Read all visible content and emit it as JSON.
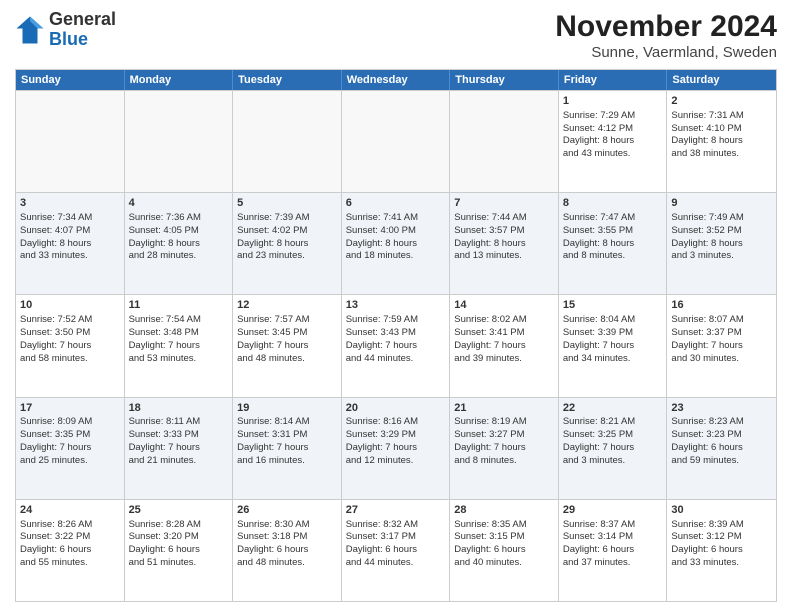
{
  "header": {
    "logo_general": "General",
    "logo_blue": "Blue",
    "month_title": "November 2024",
    "location": "Sunne, Vaermland, Sweden"
  },
  "days_of_week": [
    "Sunday",
    "Monday",
    "Tuesday",
    "Wednesday",
    "Thursday",
    "Friday",
    "Saturday"
  ],
  "weeks": [
    [
      {
        "day": "",
        "empty": true
      },
      {
        "day": "",
        "empty": true
      },
      {
        "day": "",
        "empty": true
      },
      {
        "day": "",
        "empty": true
      },
      {
        "day": "",
        "empty": true
      },
      {
        "day": "1",
        "lines": [
          "Sunrise: 7:29 AM",
          "Sunset: 4:12 PM",
          "Daylight: 8 hours",
          "and 43 minutes."
        ]
      },
      {
        "day": "2",
        "lines": [
          "Sunrise: 7:31 AM",
          "Sunset: 4:10 PM",
          "Daylight: 8 hours",
          "and 38 minutes."
        ]
      }
    ],
    [
      {
        "day": "3",
        "lines": [
          "Sunrise: 7:34 AM",
          "Sunset: 4:07 PM",
          "Daylight: 8 hours",
          "and 33 minutes."
        ]
      },
      {
        "day": "4",
        "lines": [
          "Sunrise: 7:36 AM",
          "Sunset: 4:05 PM",
          "Daylight: 8 hours",
          "and 28 minutes."
        ]
      },
      {
        "day": "5",
        "lines": [
          "Sunrise: 7:39 AM",
          "Sunset: 4:02 PM",
          "Daylight: 8 hours",
          "and 23 minutes."
        ]
      },
      {
        "day": "6",
        "lines": [
          "Sunrise: 7:41 AM",
          "Sunset: 4:00 PM",
          "Daylight: 8 hours",
          "and 18 minutes."
        ]
      },
      {
        "day": "7",
        "lines": [
          "Sunrise: 7:44 AM",
          "Sunset: 3:57 PM",
          "Daylight: 8 hours",
          "and 13 minutes."
        ]
      },
      {
        "day": "8",
        "lines": [
          "Sunrise: 7:47 AM",
          "Sunset: 3:55 PM",
          "Daylight: 8 hours",
          "and 8 minutes."
        ]
      },
      {
        "day": "9",
        "lines": [
          "Sunrise: 7:49 AM",
          "Sunset: 3:52 PM",
          "Daylight: 8 hours",
          "and 3 minutes."
        ]
      }
    ],
    [
      {
        "day": "10",
        "lines": [
          "Sunrise: 7:52 AM",
          "Sunset: 3:50 PM",
          "Daylight: 7 hours",
          "and 58 minutes."
        ]
      },
      {
        "day": "11",
        "lines": [
          "Sunrise: 7:54 AM",
          "Sunset: 3:48 PM",
          "Daylight: 7 hours",
          "and 53 minutes."
        ]
      },
      {
        "day": "12",
        "lines": [
          "Sunrise: 7:57 AM",
          "Sunset: 3:45 PM",
          "Daylight: 7 hours",
          "and 48 minutes."
        ]
      },
      {
        "day": "13",
        "lines": [
          "Sunrise: 7:59 AM",
          "Sunset: 3:43 PM",
          "Daylight: 7 hours",
          "and 44 minutes."
        ]
      },
      {
        "day": "14",
        "lines": [
          "Sunrise: 8:02 AM",
          "Sunset: 3:41 PM",
          "Daylight: 7 hours",
          "and 39 minutes."
        ]
      },
      {
        "day": "15",
        "lines": [
          "Sunrise: 8:04 AM",
          "Sunset: 3:39 PM",
          "Daylight: 7 hours",
          "and 34 minutes."
        ]
      },
      {
        "day": "16",
        "lines": [
          "Sunrise: 8:07 AM",
          "Sunset: 3:37 PM",
          "Daylight: 7 hours",
          "and 30 minutes."
        ]
      }
    ],
    [
      {
        "day": "17",
        "lines": [
          "Sunrise: 8:09 AM",
          "Sunset: 3:35 PM",
          "Daylight: 7 hours",
          "and 25 minutes."
        ]
      },
      {
        "day": "18",
        "lines": [
          "Sunrise: 8:11 AM",
          "Sunset: 3:33 PM",
          "Daylight: 7 hours",
          "and 21 minutes."
        ]
      },
      {
        "day": "19",
        "lines": [
          "Sunrise: 8:14 AM",
          "Sunset: 3:31 PM",
          "Daylight: 7 hours",
          "and 16 minutes."
        ]
      },
      {
        "day": "20",
        "lines": [
          "Sunrise: 8:16 AM",
          "Sunset: 3:29 PM",
          "Daylight: 7 hours",
          "and 12 minutes."
        ]
      },
      {
        "day": "21",
        "lines": [
          "Sunrise: 8:19 AM",
          "Sunset: 3:27 PM",
          "Daylight: 7 hours",
          "and 8 minutes."
        ]
      },
      {
        "day": "22",
        "lines": [
          "Sunrise: 8:21 AM",
          "Sunset: 3:25 PM",
          "Daylight: 7 hours",
          "and 3 minutes."
        ]
      },
      {
        "day": "23",
        "lines": [
          "Sunrise: 8:23 AM",
          "Sunset: 3:23 PM",
          "Daylight: 6 hours",
          "and 59 minutes."
        ]
      }
    ],
    [
      {
        "day": "24",
        "lines": [
          "Sunrise: 8:26 AM",
          "Sunset: 3:22 PM",
          "Daylight: 6 hours",
          "and 55 minutes."
        ]
      },
      {
        "day": "25",
        "lines": [
          "Sunrise: 8:28 AM",
          "Sunset: 3:20 PM",
          "Daylight: 6 hours",
          "and 51 minutes."
        ]
      },
      {
        "day": "26",
        "lines": [
          "Sunrise: 8:30 AM",
          "Sunset: 3:18 PM",
          "Daylight: 6 hours",
          "and 48 minutes."
        ]
      },
      {
        "day": "27",
        "lines": [
          "Sunrise: 8:32 AM",
          "Sunset: 3:17 PM",
          "Daylight: 6 hours",
          "and 44 minutes."
        ]
      },
      {
        "day": "28",
        "lines": [
          "Sunrise: 8:35 AM",
          "Sunset: 3:15 PM",
          "Daylight: 6 hours",
          "and 40 minutes."
        ]
      },
      {
        "day": "29",
        "lines": [
          "Sunrise: 8:37 AM",
          "Sunset: 3:14 PM",
          "Daylight: 6 hours",
          "and 37 minutes."
        ]
      },
      {
        "day": "30",
        "lines": [
          "Sunrise: 8:39 AM",
          "Sunset: 3:12 PM",
          "Daylight: 6 hours",
          "and 33 minutes."
        ]
      }
    ]
  ]
}
